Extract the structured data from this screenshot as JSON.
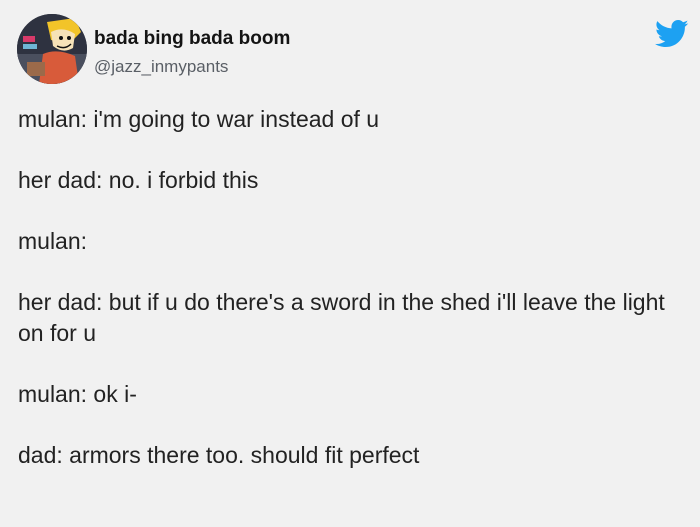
{
  "author": {
    "display_name": "bada bing bada boom",
    "handle": "@jazz_inmypants",
    "avatar_icon": "cartoon-avatar"
  },
  "platform_icon": "twitter-bird-icon",
  "colors": {
    "background": "#f1f1f1",
    "twitter_blue": "#1da1f2",
    "text": "#222222",
    "handle_text": "#5a5f66"
  },
  "tweet": {
    "lines": [
      "mulan: i'm going to war instead of u",
      "her dad: no. i forbid this",
      "mulan:",
      "her dad: but if u do there's a sword in the shed i'll leave the light on for u",
      "mulan: ok i-",
      "dad: armors there too. should fit perfect"
    ]
  }
}
